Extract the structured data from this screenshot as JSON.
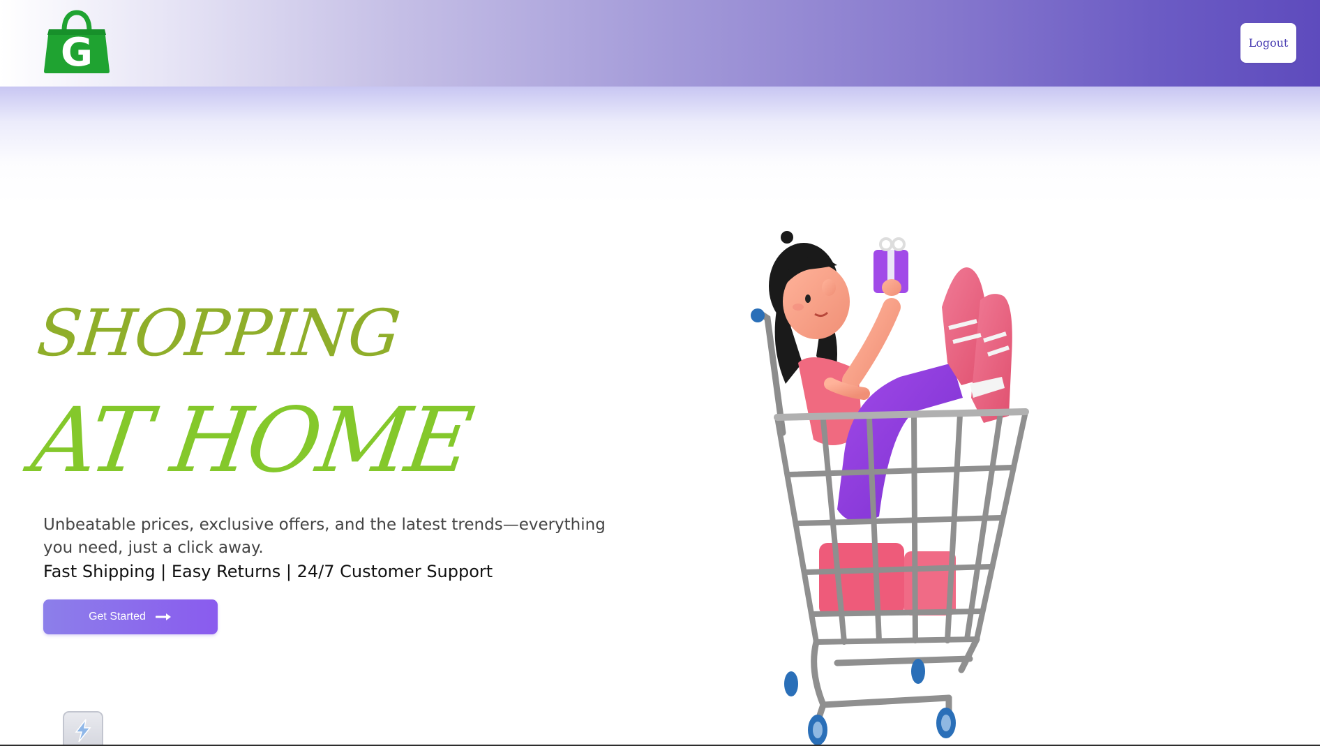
{
  "header": {
    "logo_letter": "G",
    "logo_icon": "shopping-bag-icon",
    "logout_label": "Logout"
  },
  "hero": {
    "title_line_1": "SHOPPING",
    "title_line_2": "AT HOME",
    "description": "Unbeatable prices, exclusive offers, and the latest trends—everything you need, just a click away.",
    "features": "Fast Shipping | Easy Returns | 24/7 Customer Support",
    "cta_label": "Get Started",
    "cta_icon": "arrow-right-icon"
  },
  "illustration": {
    "icon": "shopping-cart-girl-illustration"
  },
  "floating_widget": {
    "icon": "lightning-icon"
  },
  "colors": {
    "header_gradient_start": "#ffffff",
    "header_gradient_end": "#5e4bbd",
    "title_line_1": "#8fae2a",
    "title_line_2": "#84c82b",
    "cta_start": "#8c7fea",
    "cta_end": "#8a5bee",
    "logo_green": "#1fa331",
    "logout_text": "#4b3fb3"
  }
}
